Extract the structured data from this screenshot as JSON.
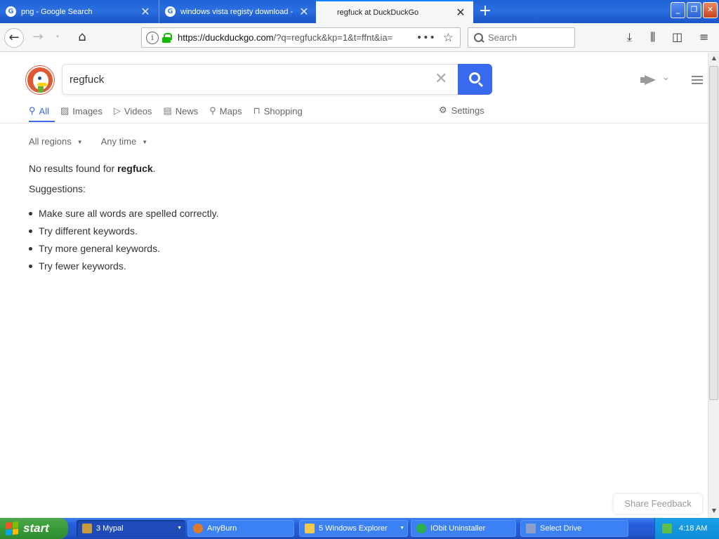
{
  "browser": {
    "tabs": [
      {
        "label": "png - Google Search",
        "favicon": "google-g-icon"
      },
      {
        "label": "windows vista registy download -",
        "favicon": "google-g-icon"
      },
      {
        "label": "regfuck at DuckDuckGo",
        "favicon": "none"
      }
    ],
    "new_tab_symbol": "+",
    "url_host": "https://duckduckgo.com",
    "url_rest": "/?q=regfuck&kp=1&t=ffnt&ia=",
    "search_placeholder": "Search"
  },
  "ddg": {
    "query": "regfuck",
    "tabs": [
      {
        "label": "All",
        "icon": "search-icon",
        "active": true
      },
      {
        "label": "Images",
        "icon": "image-icon"
      },
      {
        "label": "Videos",
        "icon": "play-icon"
      },
      {
        "label": "News",
        "icon": "newspaper-icon"
      },
      {
        "label": "Maps",
        "icon": "map-pin-icon"
      },
      {
        "label": "Shopping",
        "icon": "shopping-bag-icon"
      }
    ],
    "settings_label": "Settings",
    "filters": {
      "region": "All regions",
      "time": "Any time"
    },
    "no_results_prefix": "No results found for",
    "no_results_query": "regfuck",
    "suggestions_title": "Suggestions:",
    "suggestions": [
      "Make sure all words are spelled correctly.",
      "Try different keywords.",
      "Try more general keywords.",
      "Try fewer keywords."
    ],
    "feedback_label": "Share Feedback"
  },
  "taskbar": {
    "start_label": "start",
    "tasks": [
      {
        "label": "3 Mypal",
        "color": "#c89a3c"
      },
      {
        "label": "AnyBurn",
        "color": "#e07a2a"
      },
      {
        "label": "5 Windows Explorer",
        "color": "#f2c94c"
      },
      {
        "label": "IObit Uninstaller",
        "color": "#2bb24c"
      },
      {
        "label": "Select Drive",
        "color": "#8aa0c8"
      }
    ],
    "clock": "4:18 AM"
  },
  "colors": {
    "ddg_blue": "#3969ef",
    "ddg_orange": "#de5833",
    "xp_blue": "#245edc",
    "xp_green": "#3a9f3a"
  }
}
